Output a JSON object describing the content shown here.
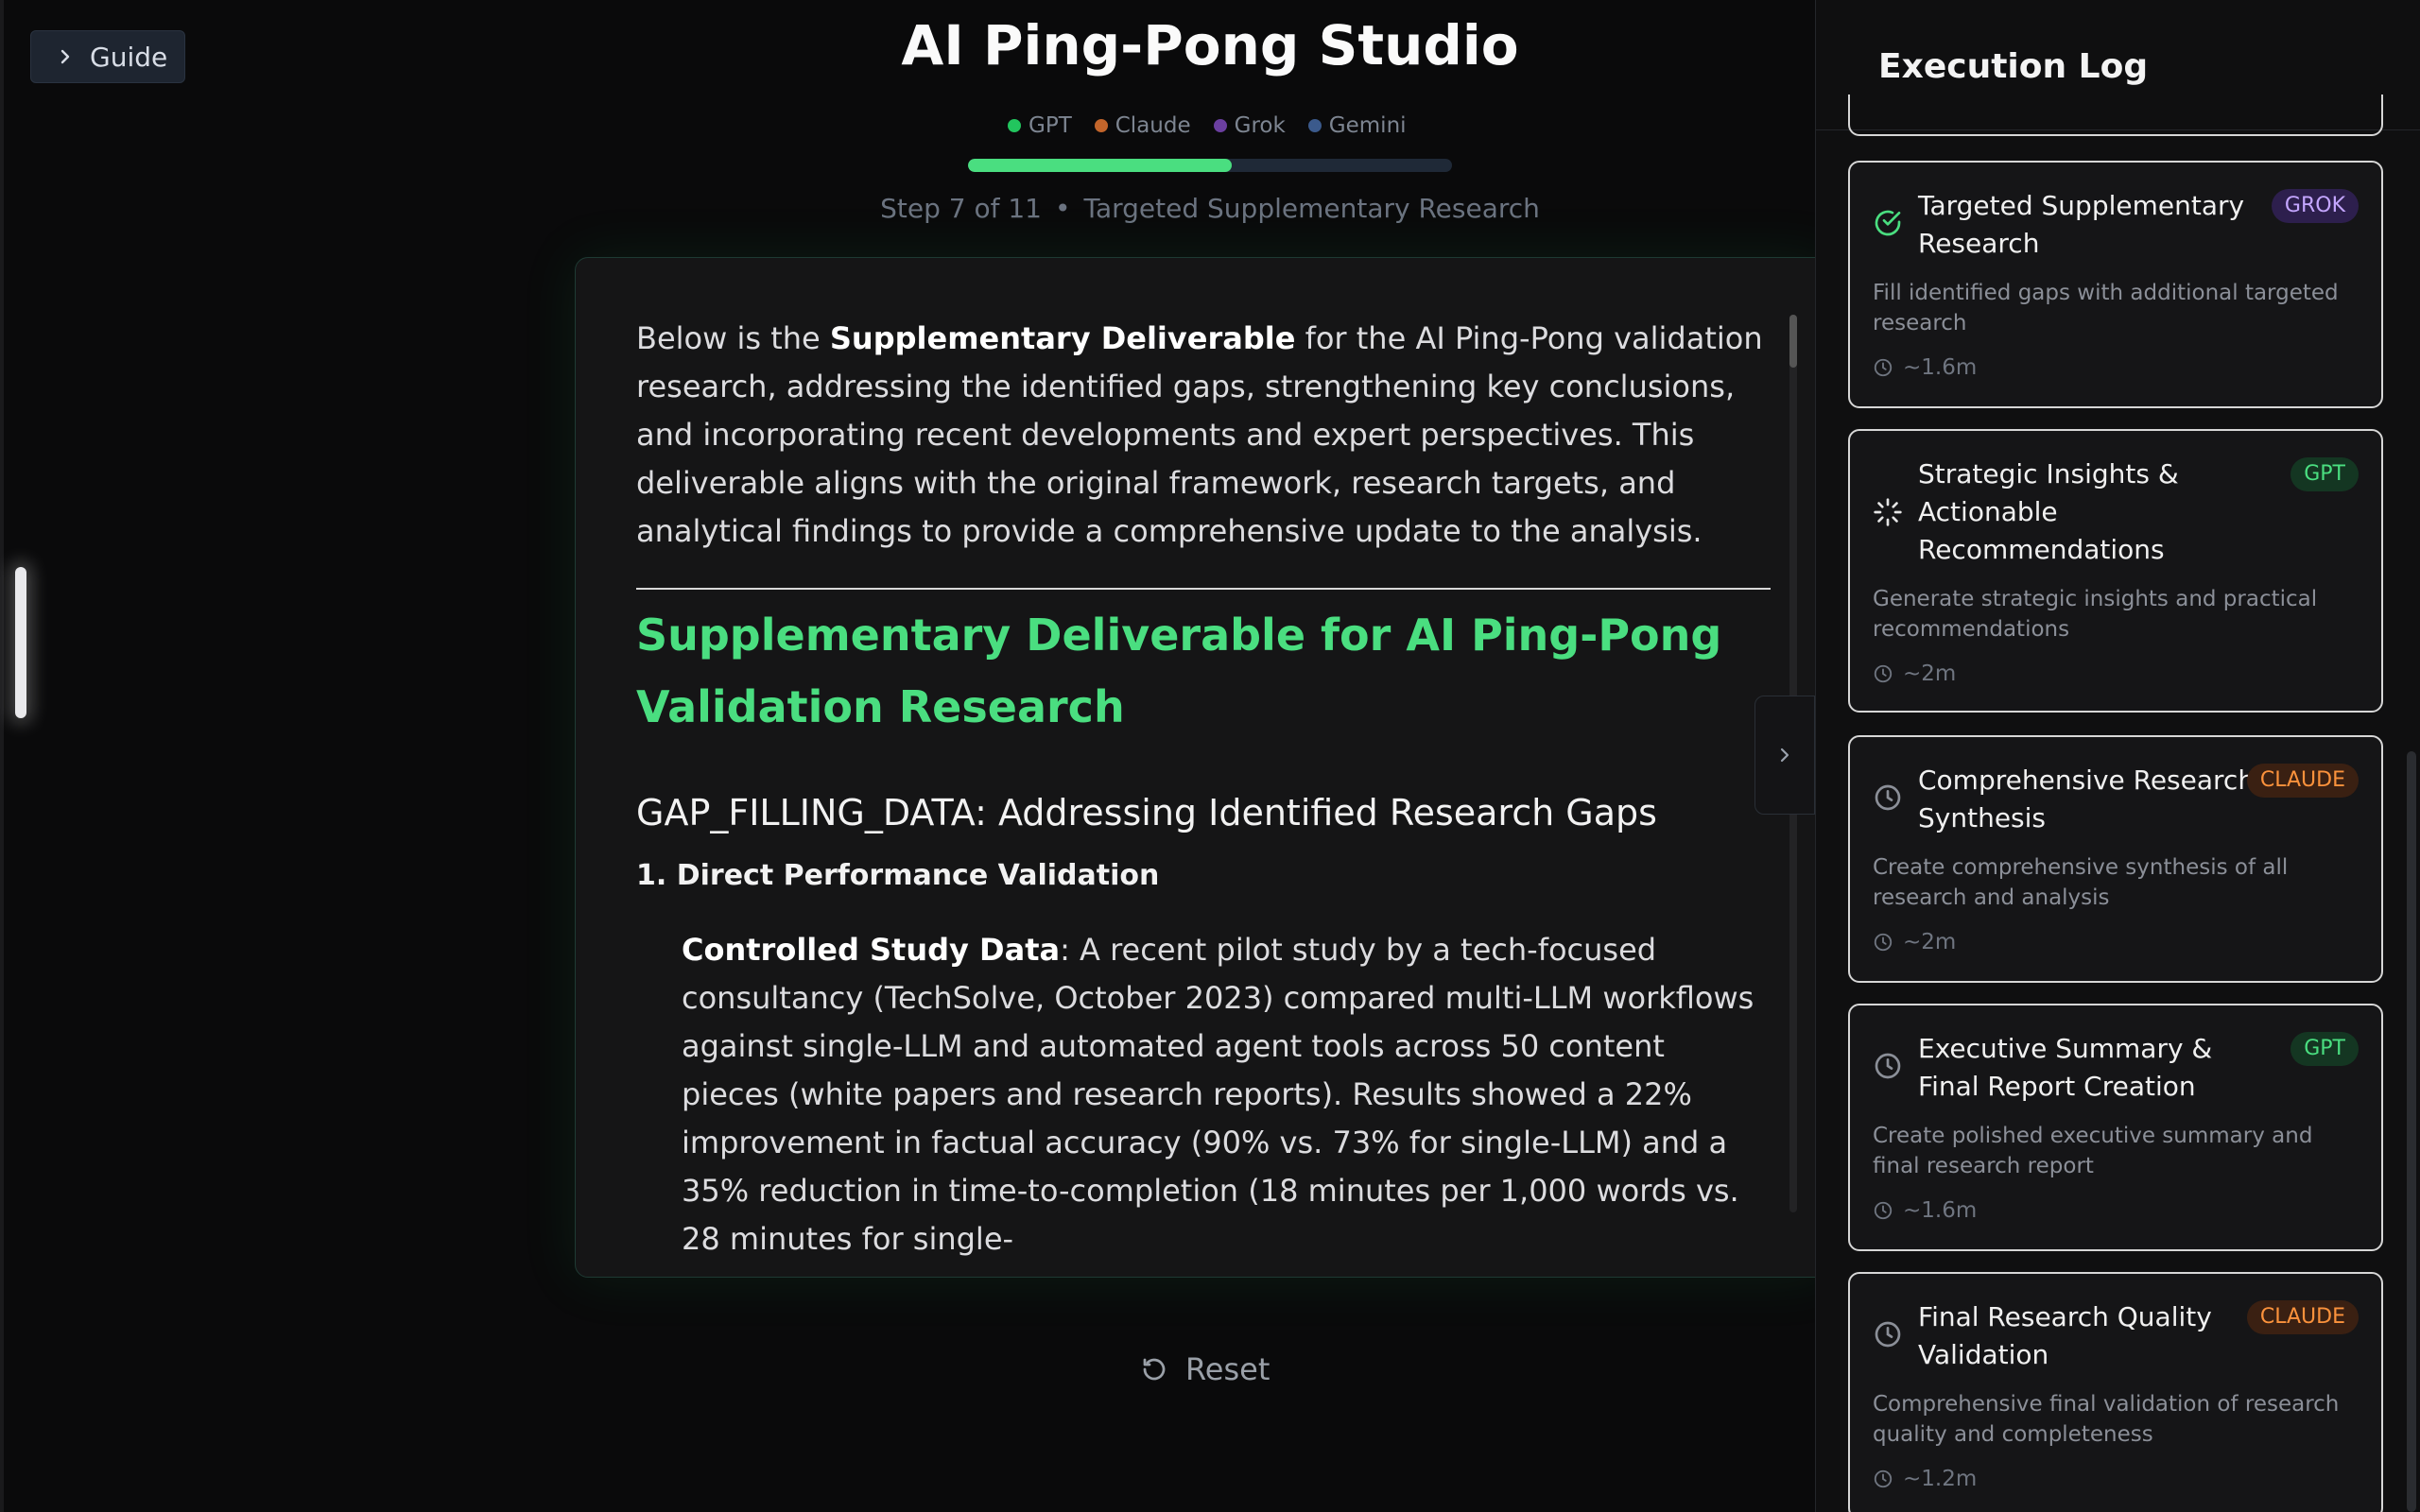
{
  "guide": {
    "label": "Guide"
  },
  "header": {
    "title": "AI Ping-Pong Studio",
    "models": [
      {
        "name": "GPT",
        "color": "#22c55e"
      },
      {
        "name": "Claude",
        "color": "#c2652b"
      },
      {
        "name": "Grok",
        "color": "#6b3fa0"
      },
      {
        "name": "Gemini",
        "color": "#3b5a8c"
      }
    ],
    "progress_fraction": 0.545,
    "step": "Step 7 of 11",
    "step_name": "Targeted Supplementary Research"
  },
  "document": {
    "intro_pre": "Below is the ",
    "intro_bold": "Supplementary Deliverable",
    "intro_post": " for the AI Ping-Pong validation research, addressing the identified gaps, strengthening key conclusions, and incorporating recent developments and expert perspectives. This deliverable aligns with the original framework, research targets, and analytical findings to provide a comprehensive update to the analysis.",
    "heading": "Supplementary Deliverable for AI Ping-Pong Validation Research",
    "section": "GAP_FILLING_DATA: Addressing Identified Research Gaps",
    "subsection": "1. Direct Performance Validation",
    "para_bold": "Controlled Study Data",
    "para_text": ": A recent pilot study by a tech-focused consultancy (TechSolve, October 2023) compared multi-LLM workflows against single-LLM and automated agent tools across 50 content pieces (white papers and research reports). Results showed a 22% improvement in factual accuracy (90% vs. 73% for single-LLM) and a 35% reduction in time-to-completion (18 minutes per 1,000 words vs. 28 minutes for single-"
  },
  "reset": {
    "label": "Reset"
  },
  "sidebar": {
    "title": "Execution Log",
    "items": [
      {
        "title": "Targeted Supplementary Research",
        "badge": "GROK",
        "desc": "Fill identified gaps with additional targeted research",
        "time": "~1.6m",
        "status_icon": "check-circle-icon"
      },
      {
        "title": "Strategic Insights & Actionable Recommendations",
        "badge": "GPT",
        "desc": "Generate strategic insights and practical recommendations",
        "time": "~2m",
        "status_icon": "spinner-icon"
      },
      {
        "title": "Comprehensive Research Synthesis",
        "badge": "CLAUDE",
        "desc": "Create comprehensive synthesis of all research and analysis",
        "time": "~2m",
        "status_icon": "clock-icon"
      },
      {
        "title": "Executive Summary & Final Report Creation",
        "badge": "GPT",
        "desc": "Create polished executive summary and final research report",
        "time": "~1.6m",
        "status_icon": "clock-icon"
      },
      {
        "title": "Final Research Quality Validation",
        "badge": "CLAUDE",
        "desc": "Comprehensive final validation of research quality and completeness",
        "time": "~1.2m",
        "status_icon": "clock-icon"
      }
    ]
  }
}
